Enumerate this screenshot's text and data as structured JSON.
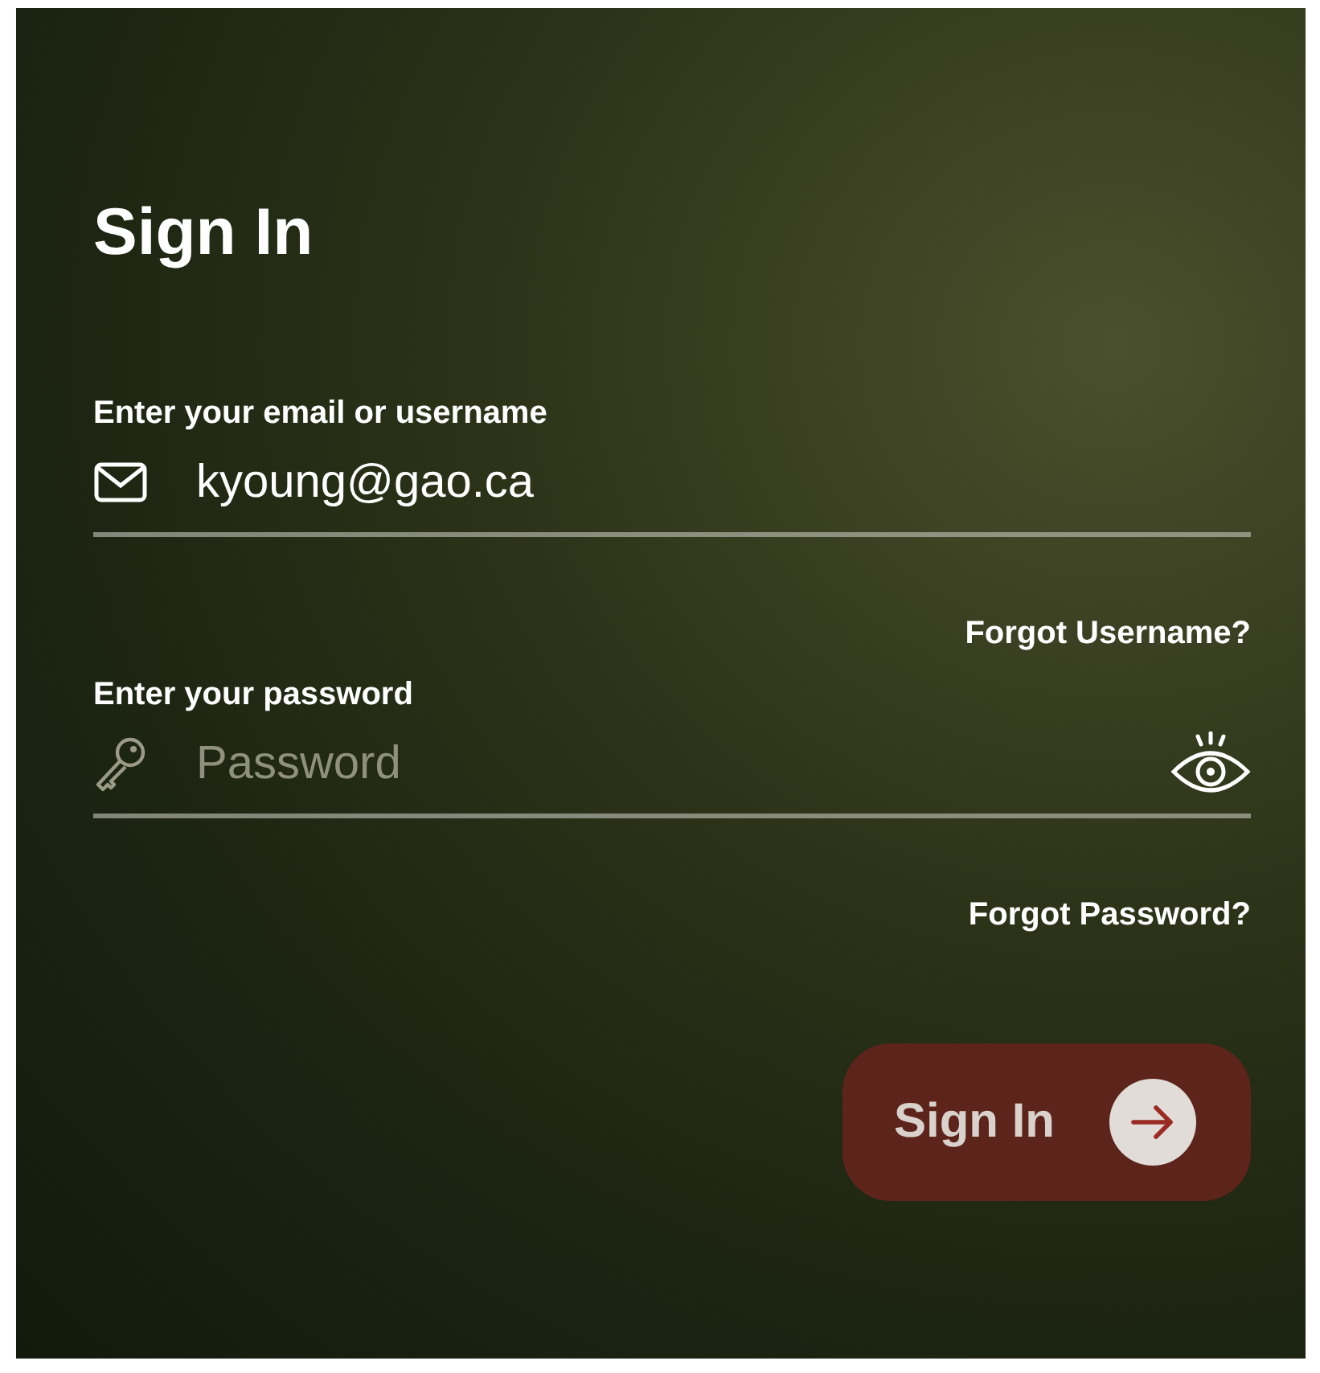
{
  "title": "Sign In",
  "email": {
    "label": "Enter your email or username",
    "value": "kyoung@gao.ca"
  },
  "forgot_username": "Forgot Username?",
  "password": {
    "label": "Enter your password",
    "placeholder": "Password"
  },
  "forgot_password": "Forgot Password?",
  "submit": {
    "label": "Sign In",
    "disabled": true
  }
}
